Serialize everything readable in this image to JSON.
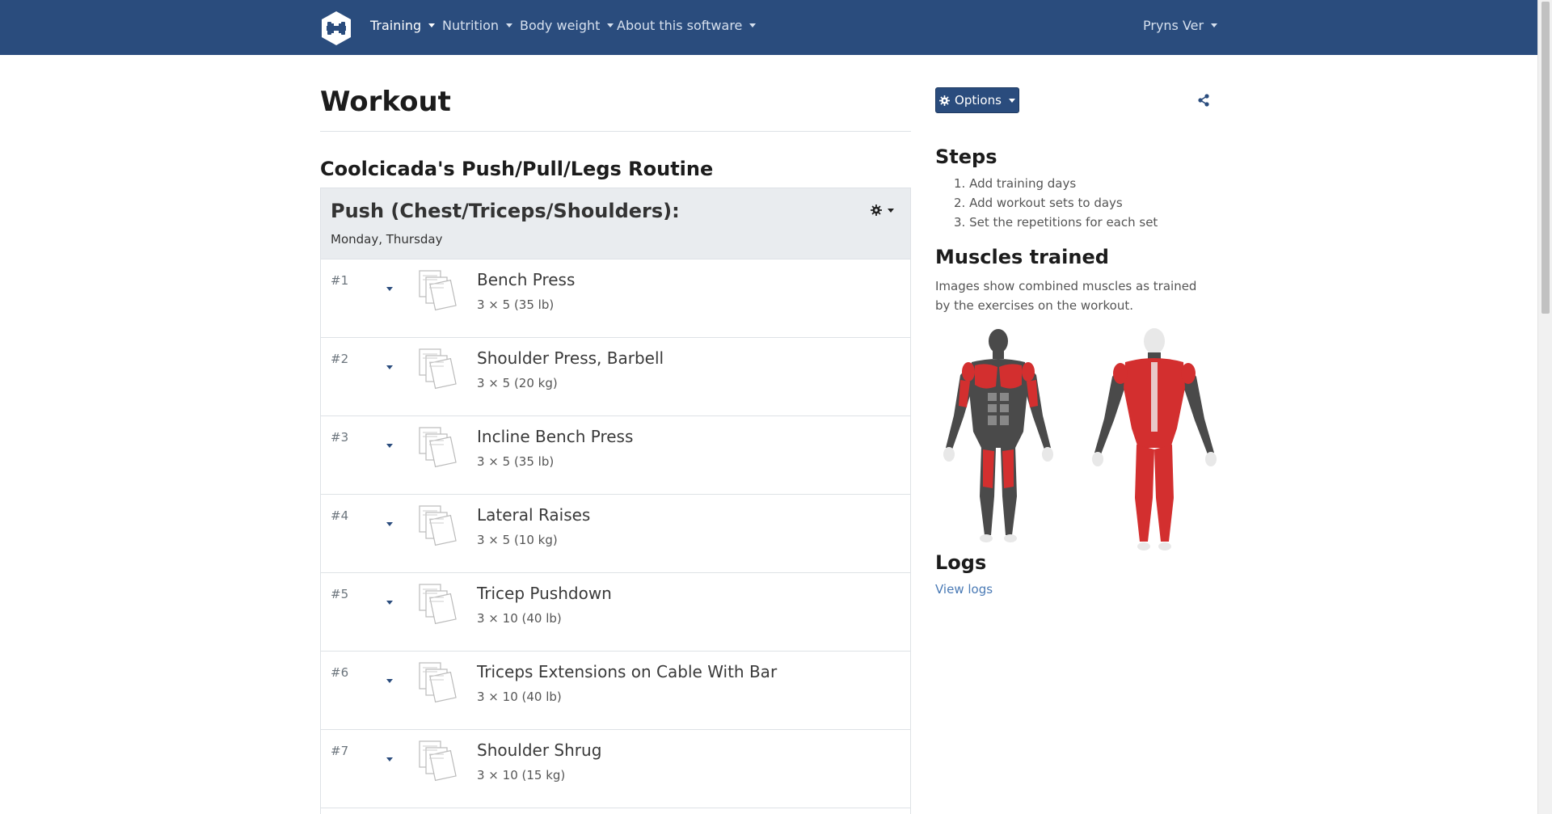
{
  "navbar": {
    "brand_icon": "dumbbell-logo-icon",
    "items": [
      {
        "label": "Training",
        "active": true
      },
      {
        "label": "Nutrition",
        "active": false
      },
      {
        "label": "Body weight",
        "active": false
      },
      {
        "label": "About this software",
        "active": false
      }
    ],
    "user_menu": "Pryns Ver",
    "bg_color": "#2a4c7d"
  },
  "main": {
    "page_title": "Workout",
    "routine_title": "Coolcicada's Push/Pull/Legs Routine",
    "day": {
      "title": "Push (Chest/Triceps/Shoulders):",
      "days": "Monday, Thursday",
      "exercises": [
        {
          "num": "#1",
          "name": "Bench Press",
          "detail": "3 × 5 (35 lb)"
        },
        {
          "num": "#2",
          "name": "Shoulder Press, Barbell",
          "detail": "3 × 5 (20 kg)"
        },
        {
          "num": "#3",
          "name": "Incline Bench Press",
          "detail": "3 × 5 (35 lb)"
        },
        {
          "num": "#4",
          "name": "Lateral Raises",
          "detail": "3 × 5 (10 kg)"
        },
        {
          "num": "#5",
          "name": "Tricep Pushdown",
          "detail": "3 × 10 (40 lb)"
        },
        {
          "num": "#6",
          "name": "Triceps Extensions on Cable With Bar",
          "detail": "3 × 10 (40 lb)"
        },
        {
          "num": "#7",
          "name": "Shoulder Shrug",
          "detail": "3 × 10 (15 kg)"
        }
      ]
    }
  },
  "sidebar": {
    "options_label": "Options",
    "steps_title": "Steps",
    "steps": [
      "1. Add training days",
      "2. Add workout sets to days",
      "3. Set the repetitions for each set"
    ],
    "muscles_title": "Muscles trained",
    "muscles_text": "Images show combined muscles as trained by the exercises on the workout.",
    "logs_title": "Logs",
    "logs_link": "View logs",
    "muscle_highlight_color": "#d32f2f"
  }
}
